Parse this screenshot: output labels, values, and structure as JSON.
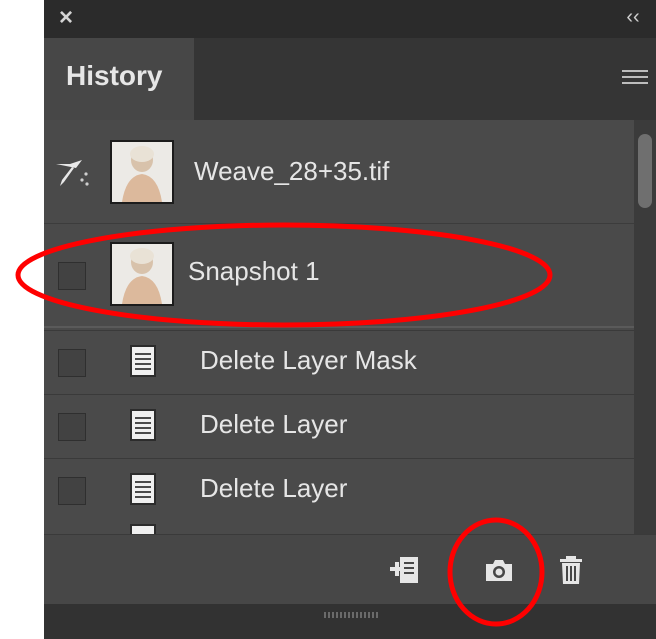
{
  "panel": {
    "close_glyph": "×",
    "collapse_glyph": "‹‹",
    "tab_label": "History",
    "menu_icon": "hamburger-icon"
  },
  "history": {
    "snapshots": [
      {
        "label": "Weave_28+35.tif",
        "icon": "history-brush-icon"
      },
      {
        "label": "Snapshot 1",
        "icon": "checkbox"
      }
    ],
    "states": [
      {
        "label": "Delete Layer Mask",
        "icon": "document-icon"
      },
      {
        "label": "Delete Layer",
        "icon": "document-icon"
      },
      {
        "label": "Delete Layer",
        "icon": "document-icon"
      }
    ]
  },
  "toolbar": {
    "new_document_icon": "new-document-from-state-icon",
    "snapshot_icon": "camera-icon",
    "delete_icon": "trash-icon"
  },
  "annotation_color": "#ff0000"
}
